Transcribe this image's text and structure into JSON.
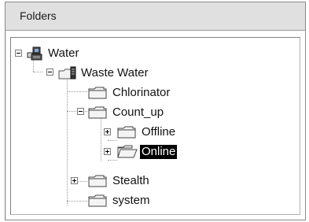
{
  "header": {
    "title": "Folders"
  },
  "tree": [
    {
      "label": "Water",
      "icon": "network-computer-icon"
    },
    {
      "label": "Waste Water",
      "icon": "server-folder-icon"
    },
    {
      "label": "Chlorinator",
      "icon": "folder-icon"
    },
    {
      "label": "Count_up",
      "icon": "folder-icon"
    },
    {
      "label": "Offline",
      "icon": "folder-icon"
    },
    {
      "label": "Online",
      "icon": "folder-open-icon",
      "selected": true
    },
    {
      "label": "Stealth",
      "icon": "folder-icon"
    },
    {
      "label": "system",
      "icon": "folder-icon"
    }
  ]
}
